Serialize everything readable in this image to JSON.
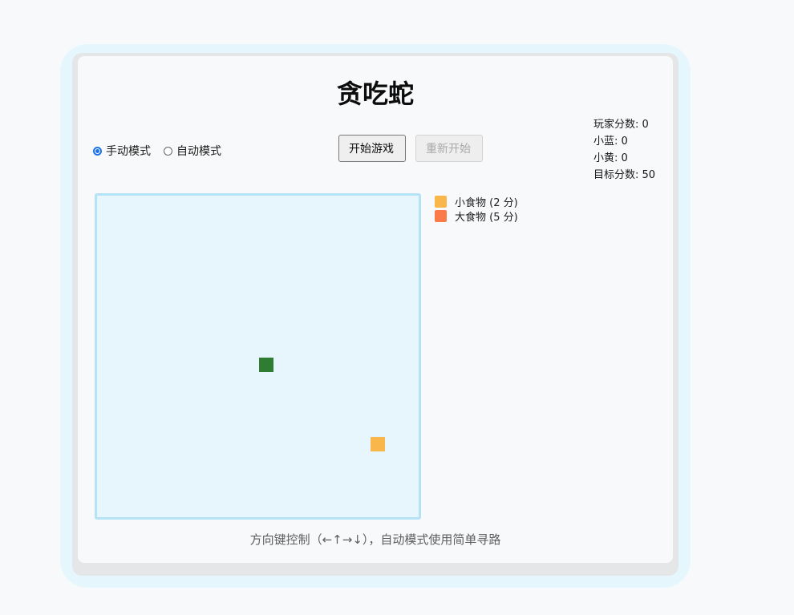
{
  "title": "贪吃蛇",
  "modes": [
    {
      "label": "手动模式",
      "checked": true
    },
    {
      "label": "自动模式",
      "checked": false
    }
  ],
  "buttons": {
    "start": "开始游戏",
    "restart": "重新开始"
  },
  "scores": {
    "player": "玩家分数: 0",
    "blue": "小蓝: 0",
    "yellow": "小黄: 0",
    "target": "目标分数: 50"
  },
  "legend": [
    {
      "label": "小食物 (2 分)",
      "color": "#f9b74b"
    },
    {
      "label": "大食物 (5 分)",
      "color": "#fb7a4a"
    }
  ],
  "board": {
    "snake_color": "#2e7d32",
    "food_color": "#f9b74b"
  },
  "hint": "方向键控制（←↑→↓），自动模式使用简单寻路"
}
